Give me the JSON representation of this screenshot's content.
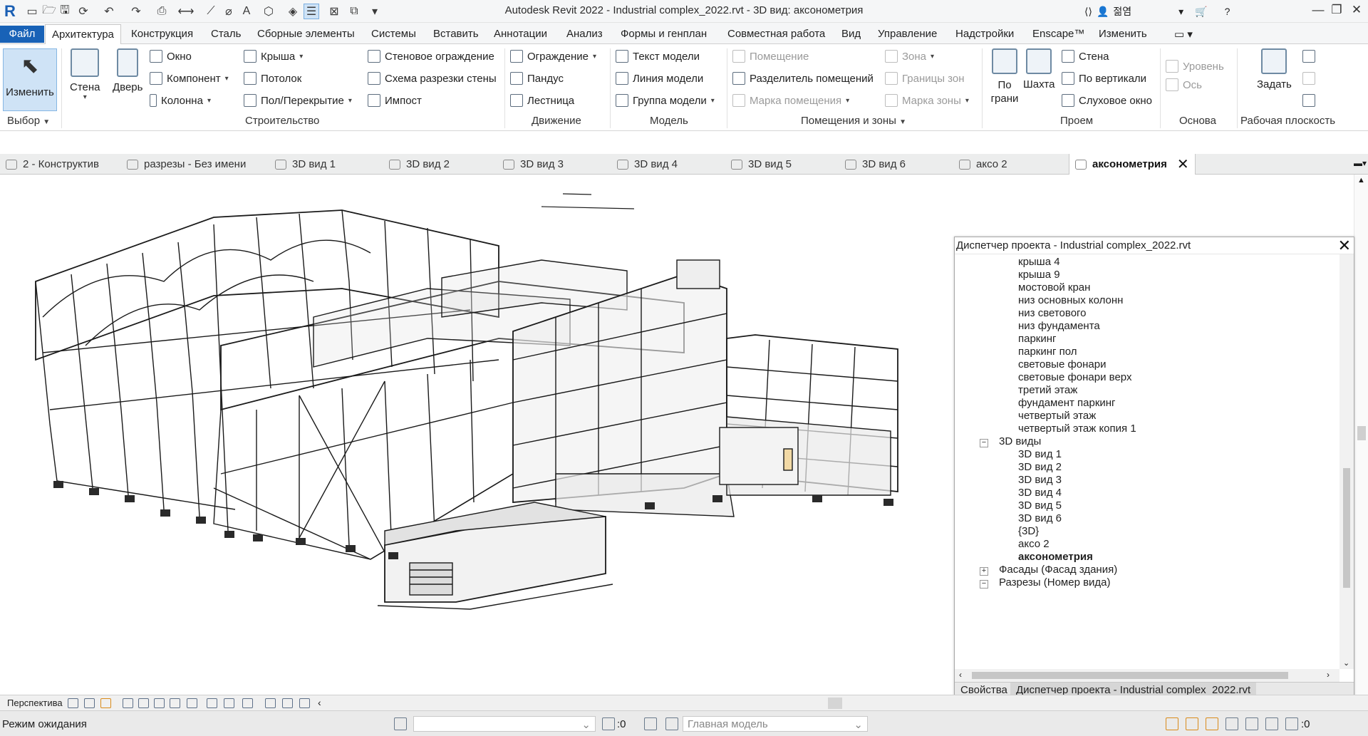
{
  "title_bar": {
    "title": "Autodesk Revit 2022 - Industrial complex_2022.rvt - 3D вид: аксонометрия",
    "app_logo": "R",
    "user_name": "젊염",
    "minimize": "—",
    "restore": "❐",
    "close": "✕"
  },
  "menu": {
    "file": "Файл",
    "tabs": [
      "Архитектура",
      "Конструкция",
      "Сталь",
      "Сборные элементы",
      "Системы",
      "Вставить",
      "Аннотации",
      "Анализ",
      "Формы и генплан",
      "Совместная работа",
      "Вид",
      "Управление",
      "Надстройки",
      "Enscape™",
      "Изменить"
    ]
  },
  "ribbon": {
    "select": {
      "button": "Изменить",
      "panel": "Выбор"
    },
    "build": {
      "panel": "Строительство",
      "wall": "Стена",
      "door": "Дверь",
      "window": "Окно",
      "component": "Компонент",
      "column": "Колонна",
      "roof": "Крыша",
      "ceiling": "Потолок",
      "floor": "Пол/Перекрытие",
      "curtain_system": "Стеновое ограждение",
      "curtain_grid": "Схема разрезки стены",
      "mullion": "Импост"
    },
    "circulation": {
      "panel": "Движение",
      "railing": "Ограждение",
      "ramp": "Пандус",
      "stair": "Лестница"
    },
    "model": {
      "panel": "Модель",
      "model_text": "Текст модели",
      "model_line": "Линия модели",
      "model_group": "Группа модели"
    },
    "room": {
      "panel": "Помещения и зоны",
      "room": "Помещение",
      "room_separator": "Разделитель помещений",
      "room_tag": "Марка помещения",
      "area": "Зона",
      "area_boundary": "Границы зон",
      "area_tag": "Марка зоны"
    },
    "opening": {
      "panel": "Проем",
      "by_face": "По грани",
      "shaft": "Шахта",
      "wall": "Стена",
      "vertical": "По вертикали",
      "dormer": "Слуховое окно"
    },
    "datum": {
      "panel": "Основа",
      "level": "Уровень",
      "grid": "Ось"
    },
    "workplane": {
      "panel": "Рабочая плоскость",
      "set": "Задать"
    }
  },
  "view_tabs": [
    "2 - Конструктив",
    "разрезы - Без имени",
    "3D вид 1",
    "3D вид 2",
    "3D вид 3",
    "3D вид 4",
    "3D вид 5",
    "3D вид 6",
    "аксо 2",
    "аксонометрия"
  ],
  "project_browser": {
    "title": "Диспетчер проекта - Industrial complex_2022.rvt",
    "level_items": [
      "крыша 4",
      "крыша 9",
      "мостовой кран",
      "низ основных колонн",
      "низ светового",
      "низ фундамента",
      "паркинг",
      "паркинг пол",
      "световые фонари",
      "световые фонари верх",
      "третий этаж",
      "фундамент паркинг",
      "четвертый этаж",
      "четвертый этаж копия 1"
    ],
    "group_3d": "3D виды",
    "views_3d": [
      "3D вид 1",
      "3D вид 2",
      "3D вид 3",
      "3D вид 4",
      "3D вид 5",
      "3D вид 6",
      "{3D}",
      "аксо 2",
      "аксонометрия"
    ],
    "group_elev": "Фасады (Фасад здания)",
    "group_sections": "Разрезы (Номер вида)",
    "tab_properties": "Свойства",
    "tab_browser": "Диспетчер проекта - Industrial complex_2022.rvt"
  },
  "view_control": {
    "projection": "Перспектива"
  },
  "status": {
    "text": "Режим ожидания",
    "worksets_count": ":0",
    "main_model": "Главная модель",
    "filter_count": ":0"
  },
  "icons": [
    "search-icon",
    "gear-icon",
    "close-icon",
    "cart-icon",
    "help-icon",
    "user-icon",
    "save-icon",
    "undo-icon",
    "redo-icon",
    "print-icon"
  ],
  "colors": {
    "file_tab": "#1862b7",
    "modify_bg": "#cfe3f6",
    "ribbon_bg": "#ffffff"
  }
}
